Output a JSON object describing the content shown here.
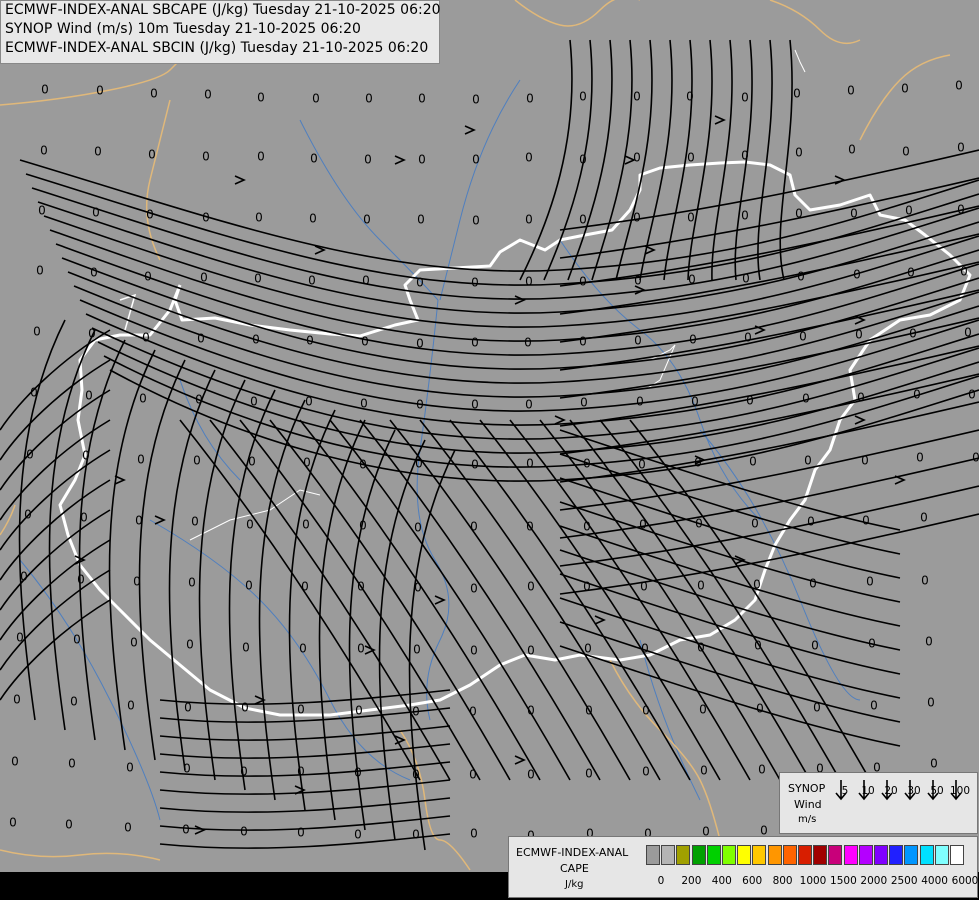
{
  "title_lines": [
    "ECMWF-INDEX-ANAL SBCAPE (J/kg) Tuesday 21-10-2025 06:20",
    "SYNOP Wind (m/s) 10m Tuesday 21-10-2025 06:20",
    "ECMWF-INDEX-ANAL SBCIN (J/kg) Tuesday 21-10-2025 06:20"
  ],
  "synop_legend": {
    "title1": "SYNOP",
    "title2": "Wind",
    "unit": "m/s",
    "speeds": [
      "5",
      "10",
      "20",
      "30",
      "50",
      "100"
    ]
  },
  "cape_legend": {
    "title1": "ECMWF-INDEX-ANAL",
    "title2": "CAPE",
    "unit": "J/kg",
    "ticks": [
      "0",
      "200",
      "400",
      "600",
      "800",
      "1000",
      "1500",
      "2000",
      "2500",
      "4000",
      "6000"
    ],
    "colors": [
      "#9b9b9b",
      "#b4b4b4",
      "#a0a000",
      "#00a000",
      "#00d000",
      "#80ff00",
      "#ffff00",
      "#ffc800",
      "#ff9600",
      "#ff6400",
      "#d81e00",
      "#a00000",
      "#c8007a",
      "#ff00ff",
      "#b400ff",
      "#8000ff",
      "#2020ff",
      "#0096ff",
      "#00e0ff",
      "#80ffff",
      "#ffffff"
    ]
  },
  "map_colors": {
    "background": "#9b9b9b",
    "country_border": "#ffffff",
    "neighbor_border": "#e0b87a",
    "river": "#4f7fbf",
    "streamline": "#000000"
  },
  "cin_value_label": "0",
  "cin_values": [
    [
      45,
      90
    ],
    [
      100,
      91
    ],
    [
      154,
      94
    ],
    [
      208,
      95
    ],
    [
      261,
      98
    ],
    [
      316,
      99
    ],
    [
      369,
      99
    ],
    [
      422,
      99
    ],
    [
      476,
      100
    ],
    [
      530,
      99
    ],
    [
      583,
      97
    ],
    [
      637,
      97
    ],
    [
      690,
      97
    ],
    [
      745,
      98
    ],
    [
      797,
      94
    ],
    [
      851,
      91
    ],
    [
      905,
      89
    ],
    [
      959,
      86
    ],
    [
      44,
      151
    ],
    [
      98,
      152
    ],
    [
      152,
      155
    ],
    [
      206,
      157
    ],
    [
      261,
      157
    ],
    [
      314,
      159
    ],
    [
      368,
      160
    ],
    [
      422,
      160
    ],
    [
      476,
      160
    ],
    [
      529,
      158
    ],
    [
      583,
      160
    ],
    [
      637,
      158
    ],
    [
      691,
      158
    ],
    [
      745,
      156
    ],
    [
      799,
      153
    ],
    [
      852,
      150
    ],
    [
      906,
      152
    ],
    [
      961,
      148
    ],
    [
      42,
      211
    ],
    [
      96,
      213
    ],
    [
      150,
      215
    ],
    [
      206,
      218
    ],
    [
      259,
      218
    ],
    [
      313,
      219
    ],
    [
      367,
      220
    ],
    [
      421,
      220
    ],
    [
      476,
      221
    ],
    [
      529,
      220
    ],
    [
      583,
      220
    ],
    [
      637,
      218
    ],
    [
      691,
      218
    ],
    [
      745,
      216
    ],
    [
      799,
      214
    ],
    [
      854,
      214
    ],
    [
      909,
      211
    ],
    [
      961,
      210
    ],
    [
      40,
      271
    ],
    [
      94,
      273
    ],
    [
      148,
      277
    ],
    [
      204,
      278
    ],
    [
      258,
      279
    ],
    [
      312,
      281
    ],
    [
      366,
      281
    ],
    [
      420,
      283
    ],
    [
      475,
      283
    ],
    [
      529,
      282
    ],
    [
      583,
      282
    ],
    [
      638,
      281
    ],
    [
      692,
      280
    ],
    [
      746,
      279
    ],
    [
      801,
      277
    ],
    [
      857,
      275
    ],
    [
      911,
      273
    ],
    [
      964,
      272
    ],
    [
      37,
      332
    ],
    [
      92,
      334
    ],
    [
      146,
      338
    ],
    [
      201,
      339
    ],
    [
      256,
      340
    ],
    [
      310,
      341
    ],
    [
      365,
      342
    ],
    [
      420,
      344
    ],
    [
      475,
      343
    ],
    [
      528,
      343
    ],
    [
      583,
      342
    ],
    [
      638,
      341
    ],
    [
      693,
      340
    ],
    [
      748,
      338
    ],
    [
      803,
      337
    ],
    [
      859,
      335
    ],
    [
      913,
      334
    ],
    [
      968,
      333
    ],
    [
      34,
      393
    ],
    [
      89,
      396
    ],
    [
      143,
      399
    ],
    [
      199,
      400
    ],
    [
      254,
      402
    ],
    [
      309,
      402
    ],
    [
      364,
      404
    ],
    [
      420,
      405
    ],
    [
      475,
      405
    ],
    [
      529,
      405
    ],
    [
      584,
      403
    ],
    [
      640,
      402
    ],
    [
      695,
      402
    ],
    [
      750,
      401
    ],
    [
      806,
      399
    ],
    [
      861,
      398
    ],
    [
      917,
      395
    ],
    [
      972,
      395
    ],
    [
      30,
      455
    ],
    [
      86,
      456
    ],
    [
      141,
      460
    ],
    [
      197,
      461
    ],
    [
      252,
      462
    ],
    [
      307,
      463
    ],
    [
      363,
      465
    ],
    [
      419,
      464
    ],
    [
      475,
      465
    ],
    [
      530,
      464
    ],
    [
      587,
      464
    ],
    [
      642,
      465
    ],
    [
      698,
      463
    ],
    [
      753,
      462
    ],
    [
      808,
      461
    ],
    [
      865,
      461
    ],
    [
      920,
      458
    ],
    [
      976,
      458
    ],
    [
      28,
      515
    ],
    [
      84,
      518
    ],
    [
      139,
      521
    ],
    [
      195,
      522
    ],
    [
      250,
      525
    ],
    [
      306,
      525
    ],
    [
      363,
      526
    ],
    [
      418,
      528
    ],
    [
      474,
      527
    ],
    [
      530,
      527
    ],
    [
      587,
      527
    ],
    [
      643,
      525
    ],
    [
      699,
      524
    ],
    [
      755,
      524
    ],
    [
      811,
      522
    ],
    [
      866,
      521
    ],
    [
      924,
      518
    ],
    [
      24,
      577
    ],
    [
      81,
      580
    ],
    [
      137,
      582
    ],
    [
      192,
      583
    ],
    [
      249,
      586
    ],
    [
      305,
      587
    ],
    [
      361,
      587
    ],
    [
      418,
      588
    ],
    [
      474,
      589
    ],
    [
      531,
      587
    ],
    [
      587,
      587
    ],
    [
      644,
      587
    ],
    [
      701,
      586
    ],
    [
      757,
      585
    ],
    [
      813,
      584
    ],
    [
      870,
      582
    ],
    [
      925,
      581
    ],
    [
      20,
      638
    ],
    [
      77,
      640
    ],
    [
      134,
      643
    ],
    [
      190,
      645
    ],
    [
      246,
      648
    ],
    [
      303,
      649
    ],
    [
      361,
      649
    ],
    [
      417,
      650
    ],
    [
      474,
      651
    ],
    [
      531,
      651
    ],
    [
      588,
      649
    ],
    [
      645,
      649
    ],
    [
      701,
      648
    ],
    [
      758,
      646
    ],
    [
      815,
      646
    ],
    [
      872,
      644
    ],
    [
      929,
      642
    ],
    [
      17,
      700
    ],
    [
      74,
      702
    ],
    [
      131,
      706
    ],
    [
      188,
      708
    ],
    [
      245,
      708
    ],
    [
      301,
      710
    ],
    [
      359,
      711
    ],
    [
      416,
      712
    ],
    [
      473,
      712
    ],
    [
      531,
      711
    ],
    [
      589,
      711
    ],
    [
      646,
      711
    ],
    [
      703,
      710
    ],
    [
      760,
      709
    ],
    [
      817,
      708
    ],
    [
      874,
      706
    ],
    [
      931,
      703
    ],
    [
      15,
      762
    ],
    [
      72,
      764
    ],
    [
      130,
      768
    ],
    [
      187,
      769
    ],
    [
      244,
      772
    ],
    [
      301,
      772
    ],
    [
      358,
      773
    ],
    [
      416,
      775
    ],
    [
      473,
      775
    ],
    [
      531,
      775
    ],
    [
      589,
      774
    ],
    [
      646,
      772
    ],
    [
      704,
      771
    ],
    [
      762,
      770
    ],
    [
      820,
      769
    ],
    [
      877,
      768
    ],
    [
      934,
      764
    ],
    [
      13,
      823
    ],
    [
      69,
      825
    ],
    [
      128,
      828
    ],
    [
      186,
      830
    ],
    [
      244,
      832
    ],
    [
      301,
      833
    ],
    [
      358,
      835
    ],
    [
      416,
      835
    ],
    [
      474,
      834
    ],
    [
      531,
      836
    ],
    [
      590,
      834
    ],
    [
      648,
      834
    ],
    [
      706,
      832
    ],
    [
      764,
      831
    ],
    [
      822,
      830
    ],
    [
      881,
      828
    ],
    [
      934,
      826
    ]
  ]
}
